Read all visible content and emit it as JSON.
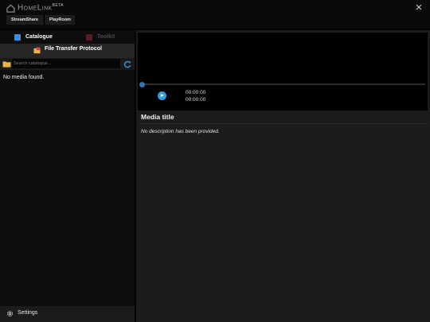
{
  "window": {
    "brand": "HomeLink",
    "brand_badge": "BETA",
    "apps": [
      "StreamShare",
      "PlayRoom"
    ],
    "close_icon": "close-icon"
  },
  "sidebar": {
    "tabs": [
      {
        "label": "Catalogue",
        "icon": "catalogue-icon",
        "active": true,
        "color": "#3b8fd9"
      },
      {
        "label": "Toolkit",
        "icon": "toolkit-icon",
        "active": false,
        "color": "#5c1a26"
      }
    ],
    "section_title": "File Transfer Protocol",
    "section_icon": "ftp-icon",
    "search": {
      "placeholder": "Search catalogue...",
      "value": ""
    },
    "empty_message": "No media found.",
    "settings_label": "Settings"
  },
  "player": {
    "current_time": "00:00:00",
    "total_time": "00:00:00",
    "progress": 0,
    "accent": "#2e9fe6"
  },
  "media": {
    "title": "Media title",
    "description": "No description has been provided."
  }
}
